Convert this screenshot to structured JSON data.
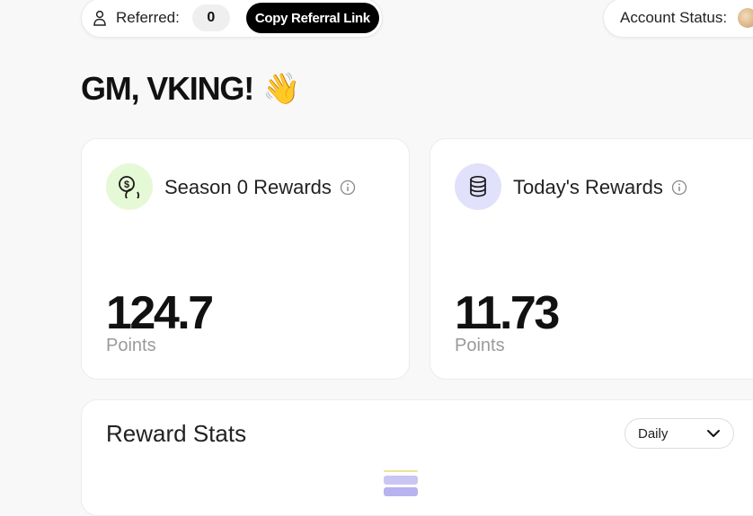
{
  "header": {
    "referred_label": "Referred:",
    "referred_count": "0",
    "copy_referral_label": "Copy Referral Link",
    "account_status_label": "Account Status:"
  },
  "greeting": {
    "text": "GM, VKING!",
    "emoji": "👋"
  },
  "cards": [
    {
      "title": "Season 0 Rewards",
      "value": "124.7",
      "unit": "Points",
      "icon": "dollar-coins-icon",
      "icon_bg": "#e6f9d6"
    },
    {
      "title": "Today's Rewards",
      "value": "11.73",
      "unit": "Points",
      "icon": "coin-stack-icon",
      "icon_bg": "#e2e1fb"
    }
  ],
  "reward_stats": {
    "title": "Reward Stats",
    "period_selected": "Daily",
    "bar_colors": [
      "#f0e29a",
      "#c9c6f4",
      "#b7b2f0"
    ]
  },
  "colors": {
    "background": "#f8f8f8",
    "button_dark": "#000000",
    "muted_text": "#9a9a9a"
  }
}
